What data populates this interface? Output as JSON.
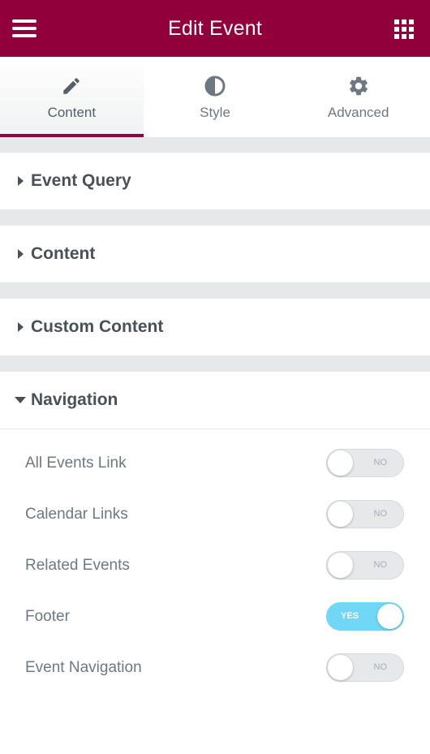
{
  "header": {
    "title": "Edit Event",
    "menu_icon": "hamburger-icon",
    "apps_icon": "grid-apps-icon",
    "background": "#92003b"
  },
  "tabs": [
    {
      "label": "Content",
      "icon": "pencil-icon",
      "active": true
    },
    {
      "label": "Style",
      "icon": "half-circle-icon",
      "active": false
    },
    {
      "label": "Advanced",
      "icon": "gear-icon",
      "active": false
    }
  ],
  "sections": [
    {
      "title": "Event Query",
      "expanded": false
    },
    {
      "title": "Content",
      "expanded": false
    },
    {
      "title": "Custom Content",
      "expanded": false
    },
    {
      "title": "Navigation",
      "expanded": true
    }
  ],
  "navigation_controls": [
    {
      "label": "All Events Link",
      "value": "NO",
      "on": false
    },
    {
      "label": "Calendar Links",
      "value": "NO",
      "on": false
    },
    {
      "label": "Related Events",
      "value": "NO",
      "on": false
    },
    {
      "label": "Footer",
      "value": "YES",
      "on": true
    },
    {
      "label": "Event Navigation",
      "value": "NO",
      "on": false
    }
  ],
  "colors": {
    "accent": "#92003b",
    "toggle_on": "#71d7f7",
    "toggle_off": "#e6e8ea"
  }
}
